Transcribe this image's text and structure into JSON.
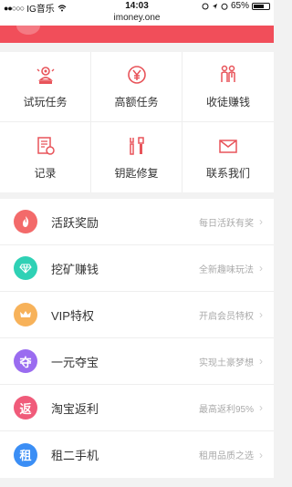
{
  "status_bar": {
    "carrier": "IG音乐",
    "signal": "●●○○○",
    "time": "14:03",
    "battery": "65%"
  },
  "url": "imoney.one",
  "colors": {
    "brand_red": "#f14e5a",
    "icon_red": "#e8545a"
  },
  "grid": [
    {
      "label": "试玩任务",
      "icon": "speaker-person-icon"
    },
    {
      "label": "高额任务",
      "icon": "yen-coin-icon"
    },
    {
      "label": "收徒赚钱",
      "icon": "people-icon"
    },
    {
      "label": "记录",
      "icon": "document-icon"
    },
    {
      "label": "钥匙修复",
      "icon": "tools-icon"
    },
    {
      "label": "联系我们",
      "icon": "mail-icon"
    }
  ],
  "list": [
    {
      "title": "活跃奖励",
      "sub": "每日活跃有奖",
      "badge_color": "#f36a6a",
      "badge_text": "",
      "icon": "flame-icon"
    },
    {
      "title": "挖矿赚钱",
      "sub": "全新趣味玩法",
      "badge_color": "#2fd1b5",
      "badge_text": "",
      "icon": "diamond-icon"
    },
    {
      "title": "VIP特权",
      "sub": "开启会员特权",
      "badge_color": "#f7b25a",
      "badge_text": "",
      "icon": "crown-icon"
    },
    {
      "title": "一元夺宝",
      "sub": "实现土豪梦想",
      "badge_color": "#9a6cf0",
      "badge_text": "夺",
      "icon": "treasure-icon"
    },
    {
      "title": "淘宝返利",
      "sub": "最高返利95%",
      "badge_color": "#f05b7a",
      "badge_text": "返",
      "icon": "rebate-icon"
    },
    {
      "title": "租二手机",
      "sub": "租用品质之选",
      "badge_color": "#3b8ef5",
      "badge_text": "租",
      "icon": "rent-icon"
    }
  ]
}
